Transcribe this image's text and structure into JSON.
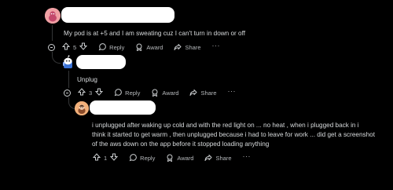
{
  "comments": [
    {
      "text": "My pod is at +5 and I am sweating cuz I can't turn in down or off",
      "votes": "5",
      "reply_label": "Reply",
      "award_label": "Award",
      "share_label": "Share",
      "more_label": "···"
    },
    {
      "text": "Unplug",
      "votes": "3",
      "reply_label": "Reply",
      "award_label": "Award",
      "share_label": "Share",
      "more_label": "···"
    },
    {
      "text_lines": [
        "i unplugged after waking up cold and with the red light on ... no heat , when i plugged back in i",
        "think it started to get warm , then unplugged because i had to leave for work ... did get a screenshot",
        "of the aws down on the app before it stopped loading anything"
      ],
      "votes": "1",
      "reply_label": "Reply",
      "award_label": "Award",
      "share_label": "Share",
      "more_label": "···"
    }
  ],
  "colors": {
    "background": "#000000",
    "text": "#d7dadc",
    "meta": "#b6b9bc",
    "thread_line": "#343536",
    "redacted": "#ffffff"
  }
}
